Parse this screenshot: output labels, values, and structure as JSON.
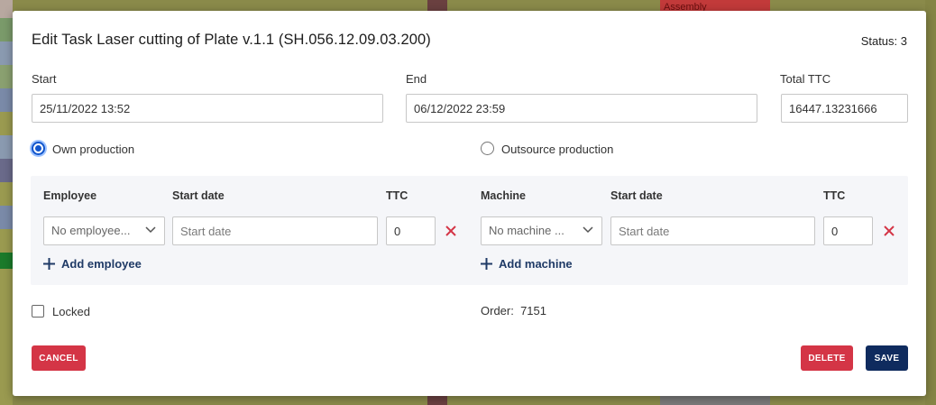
{
  "background": {
    "label": "Assembly"
  },
  "dialog": {
    "title": "Edit Task Laser cutting of Plate v.1.1 (SH.056.12.09.03.200)",
    "status": "Status: 3"
  },
  "fields": {
    "start_label": "Start",
    "start_value": "25/11/2022 13:52",
    "end_label": "End",
    "end_value": "06/12/2022 23:59",
    "total_ttc_label": "Total TTC",
    "total_ttc_value": "16447.13231666"
  },
  "production": {
    "own_label": "Own production",
    "own_selected": true,
    "outsource_label": "Outsource production",
    "outsource_selected": false
  },
  "employee_section": {
    "col_employee": "Employee",
    "col_start_date": "Start date",
    "col_ttc": "TTC",
    "employee_value": "No employee...",
    "start_date_placeholder": "Start date",
    "ttc_value": "0",
    "add_label": "Add employee"
  },
  "machine_section": {
    "col_machine": "Machine",
    "col_start_date": "Start date",
    "col_ttc": "TTC",
    "machine_value": "No machine ...",
    "start_date_placeholder": "Start date",
    "ttc_value": "0",
    "add_label": "Add machine"
  },
  "locked": {
    "label": "Locked",
    "checked": false
  },
  "order": {
    "label": "Order:",
    "value": "7151"
  },
  "buttons": {
    "cancel": "CANCEL",
    "delete": "DELETE",
    "save": "SAVE"
  },
  "colors": {
    "accent_red": "#d43546",
    "accent_blue": "#0f2b5e",
    "radio_blue": "#1155cc"
  }
}
